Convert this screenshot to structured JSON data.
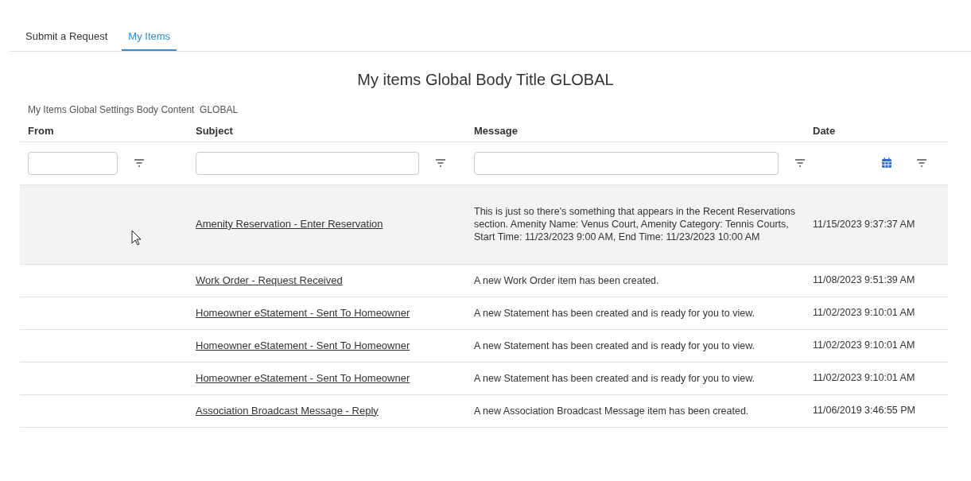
{
  "tabs": [
    {
      "label": "Submit a Request",
      "selected": false
    },
    {
      "label": "My Items",
      "selected": true
    }
  ],
  "title": "My items Global Body Title GLOBAL",
  "body_content": "My Items Global Settings Body Content  GLOBAL",
  "table": {
    "columns": [
      "From",
      "Subject",
      "Message",
      "Date"
    ],
    "rows": [
      {
        "subject": "Amenity Reservation - Enter Reservation",
        "message": "This is just so there's something that appears in the Recent Reservations section. Amenity Name: Venus Court, Amenity Category: Tennis Courts, Start Time: 11/23/2023 9:00 AM, End Time: 11/23/2023 10:00 AM",
        "date": "11/15/2023 9:37:37 AM",
        "highlighted": true
      },
      {
        "subject": "Work Order - Request Received",
        "message": "A new Work Order item has been created.",
        "date": "11/08/2023 9:51:39 AM",
        "highlighted": false
      },
      {
        "subject": "Homeowner eStatement - Sent To Homeowner",
        "message": "A new Statement has been created and is ready for you to view.",
        "date": "11/02/2023 9:10:01 AM",
        "highlighted": false
      },
      {
        "subject": "Homeowner eStatement - Sent To Homeowner",
        "message": "A new Statement has been created and is ready for you to view.",
        "date": "11/02/2023 9:10:01 AM",
        "highlighted": false
      },
      {
        "subject": "Homeowner eStatement - Sent To Homeowner",
        "message": "A new Statement has been created and is ready for you to view.",
        "date": "11/02/2023 9:10:01 AM",
        "highlighted": false
      },
      {
        "subject": "Association Broadcast Message - Reply",
        "message": "A new Association Broadcast Message item has been created.",
        "date": "11/06/2019 3:46:55 PM",
        "highlighted": false
      }
    ]
  }
}
